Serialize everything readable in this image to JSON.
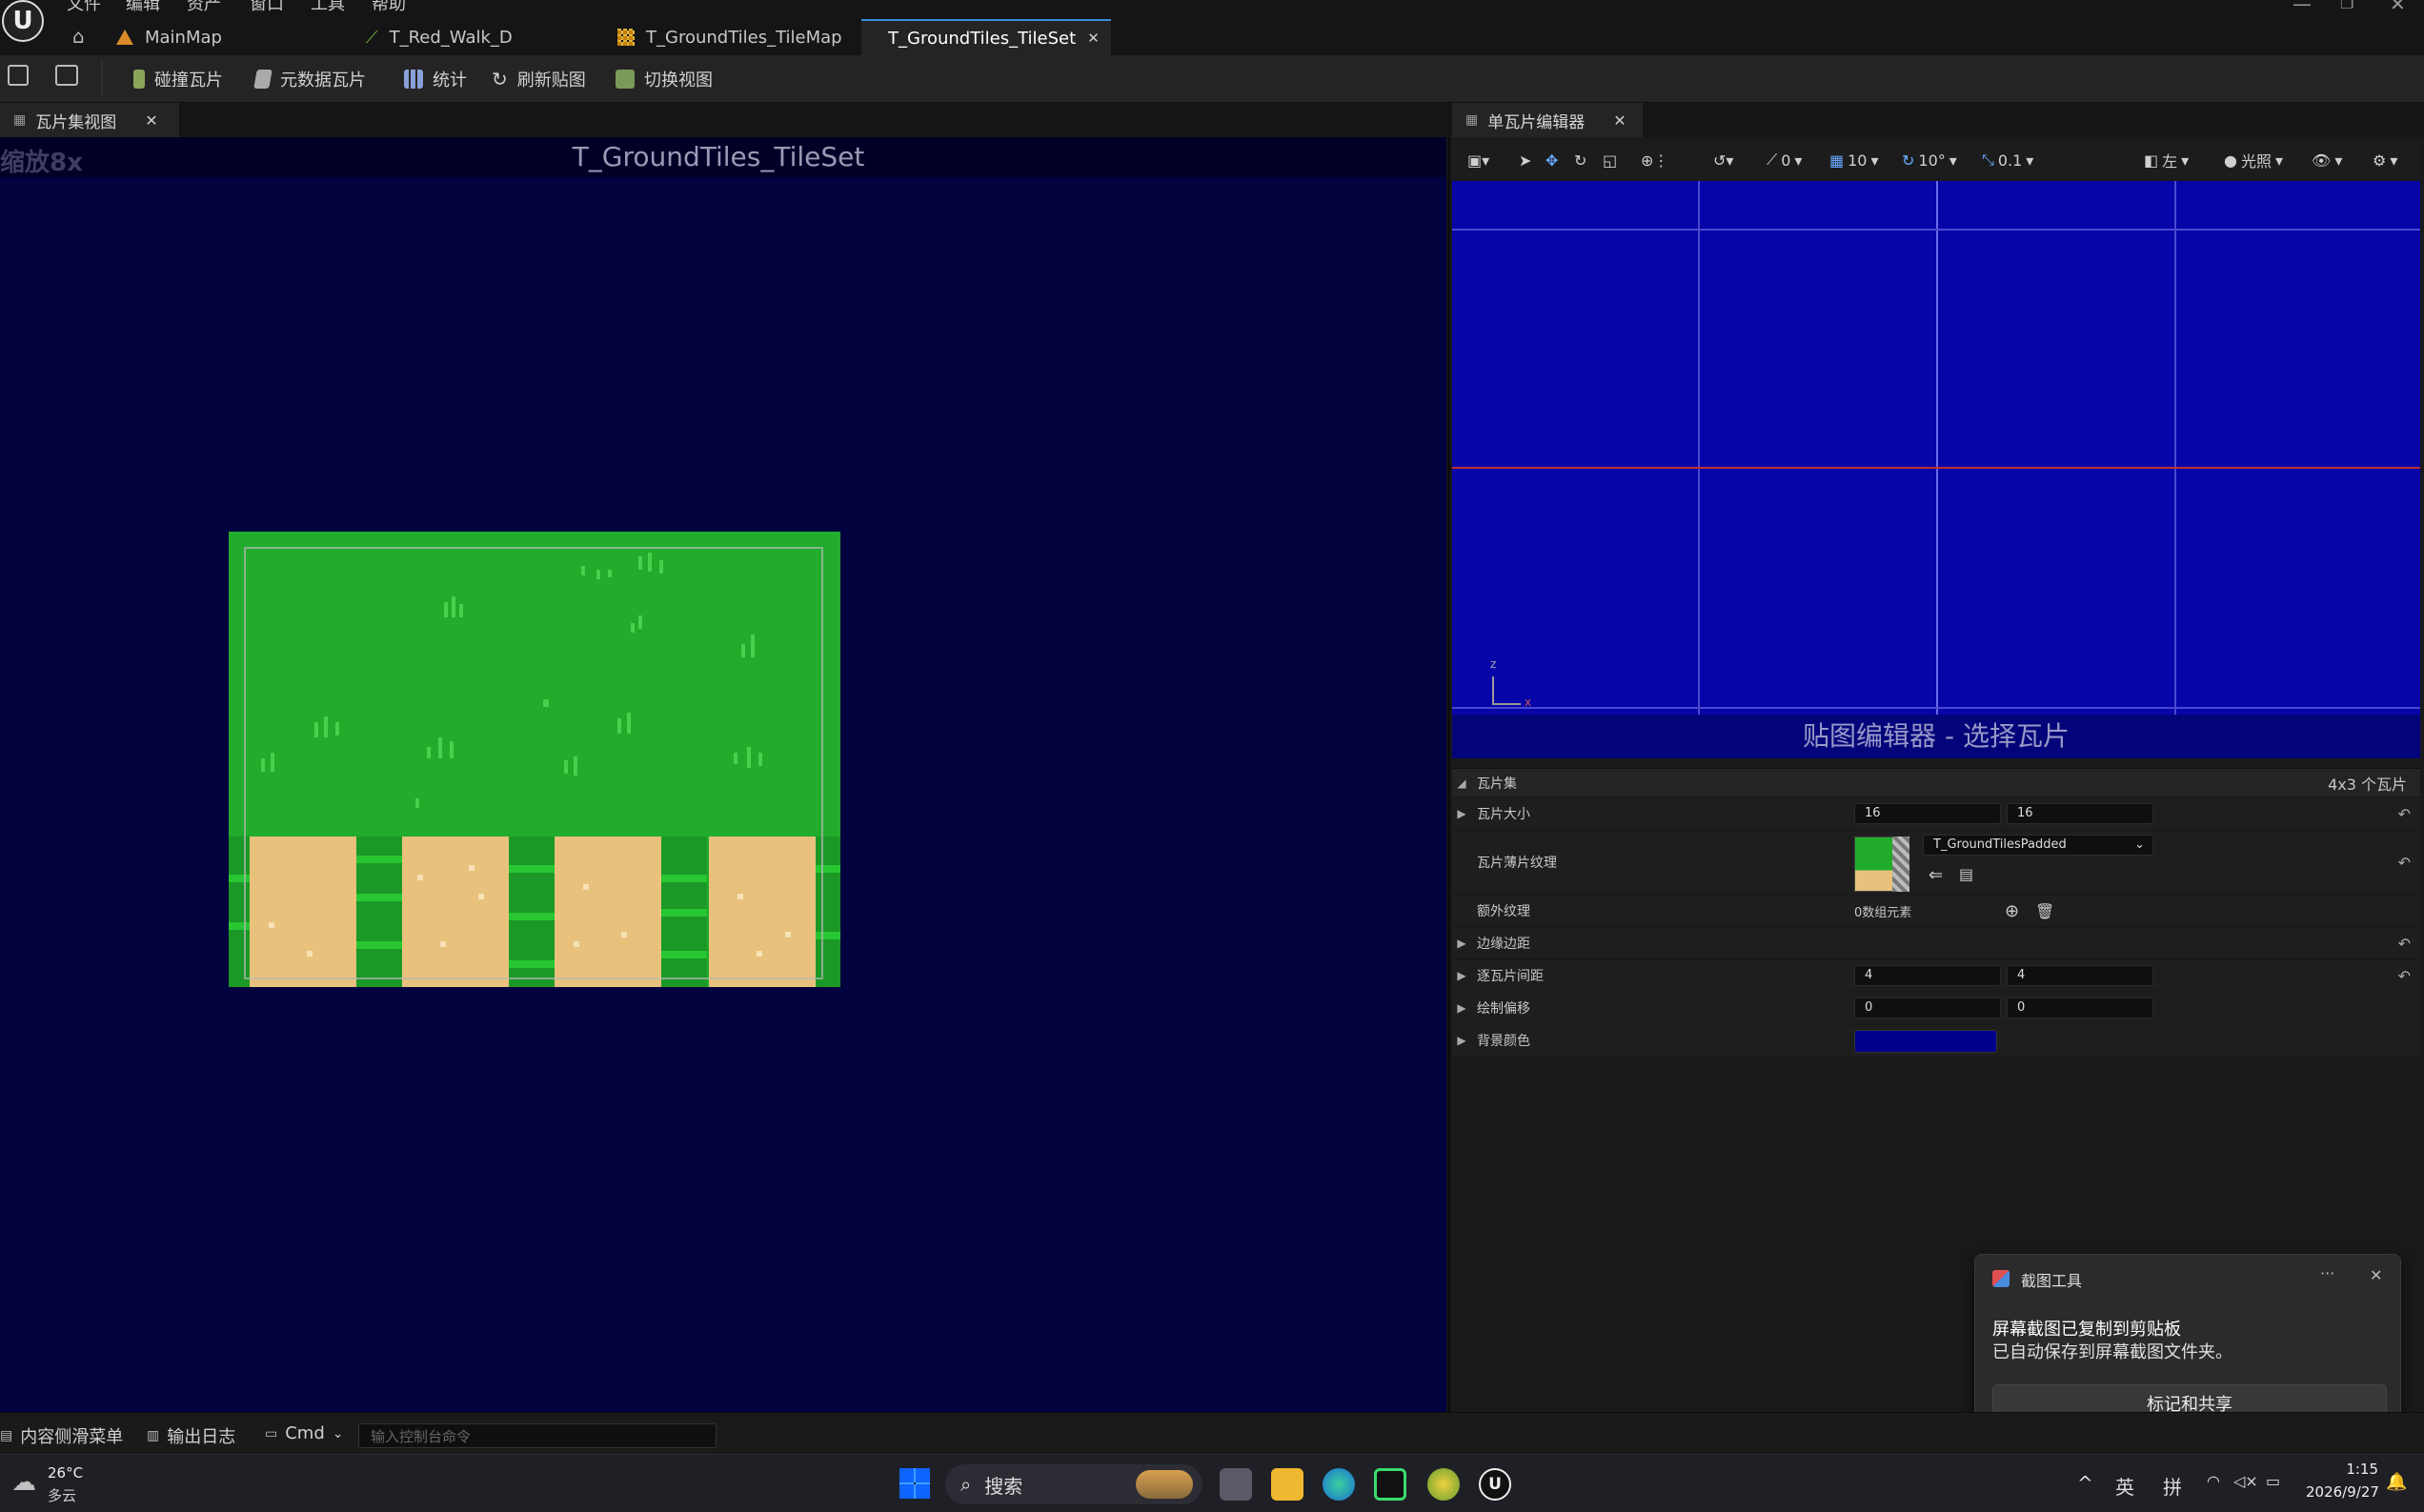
{
  "menu": [
    "文件",
    "编辑",
    "资产",
    "窗口",
    "工具",
    "帮助"
  ],
  "doc_tabs": [
    {
      "label": "MainMap",
      "icon": "map-icon"
    },
    {
      "label": "T_Red_Walk_D",
      "icon": "flipbook-icon"
    },
    {
      "label": "T_GroundTiles_TileMap",
      "icon": "tilemap-icon"
    },
    {
      "label": "T_GroundTiles_TileSet",
      "icon": "tileset-icon",
      "active": true
    }
  ],
  "toolbar": {
    "collision_tiles": "碰撞瓦片",
    "metadata_tiles": "元数据瓦片",
    "stats": "统计",
    "refresh_textures": "刷新贴图",
    "toggle_view": "切换视图"
  },
  "left_panel": {
    "tab_label": "瓦片集视图",
    "zoom": "缩放8x",
    "title": "T_GroundTiles_TileSet"
  },
  "right_panel": {
    "tab_label": "单瓦片编辑器",
    "vp_toolbar": {
      "rotate_snap": "0",
      "grid_snap": "10",
      "angle_snap": "10°",
      "scale_snap": "0.1",
      "view_mode": "左",
      "lighting": "光照"
    },
    "viewport_caption": "贴图编辑器 - 选择瓦片",
    "axis_z": "z",
    "axis_x": "x"
  },
  "details": {
    "section": "瓦片集",
    "section_info": "4x3 个瓦片",
    "rows": [
      {
        "label": "瓦片大小",
        "v1": "16",
        "v2": "16"
      },
      {
        "label": "瓦片薄片纹理",
        "texture": "T_GroundTilesPadded"
      },
      {
        "label": "额外纹理",
        "value": "0数组元素"
      },
      {
        "label": "边缘边距"
      },
      {
        "label": "逐瓦片间距",
        "v1": "4",
        "v2": "4"
      },
      {
        "label": "绘制偏移",
        "v1": "0",
        "v2": "0"
      },
      {
        "label": "背景颜色"
      }
    ],
    "bg_color": "#00008a"
  },
  "toast": {
    "app": "截图工具",
    "title": "屏幕截图已复制到剪贴板",
    "body": "已自动保存到屏幕截图文件夹。",
    "button": "标记和共享",
    "more": "···"
  },
  "statusbar": {
    "content_drawer": "内容侧滑菜单",
    "output_log": "输出日志",
    "cmd": "Cmd",
    "cmd_placeholder": "输入控制台命令"
  },
  "taskbar": {
    "temp": "26°C",
    "weather": "多云",
    "search": "搜索",
    "ime1": "英",
    "ime2": "拼",
    "time": "1:15",
    "date": "2026/9/27"
  }
}
